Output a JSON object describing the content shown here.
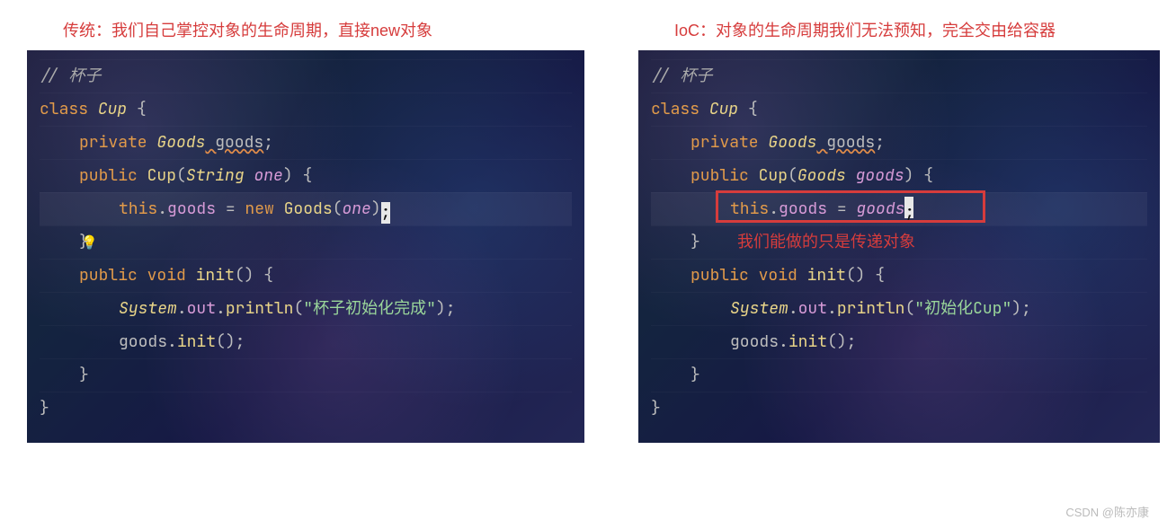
{
  "left": {
    "title": "传统：我们自己掌控对象的生命周期，直接new对象",
    "comment": "// 杯子",
    "l_class": "class ",
    "l_cup": "Cup",
    "l_ob": " {",
    "priv": "private ",
    "goods_t": "Goods",
    "goods_f": " goods",
    "semi": ";",
    "pub": "public ",
    "cup_ctor": "Cup",
    "lp": "(",
    "string_t": "String",
    "one_p": " one",
    "rp": ")",
    "ob": " {",
    "this_kw": "this",
    "dot": ".",
    "goods_f2": "goods",
    "eq": " = ",
    "new_kw": "new ",
    "goods_ctor": "Goods",
    "one_p2": "one",
    "cb": "}",
    "void_t": "void",
    "init_m": " init",
    "empty_p": "()",
    "sys": "System",
    "out": "out",
    "println": "println",
    "str1": "\"杯子初始化完成\"",
    "goods_call": "goods",
    "init_call": "init"
  },
  "right": {
    "title": "IoC：对象的生命周期我们无法预知，完全交由给容器",
    "comment": "// 杯子",
    "l_class": "class ",
    "l_cup": "Cup",
    "l_ob": " {",
    "priv": "private ",
    "goods_t": "Goods",
    "goods_f": " goods",
    "semi": ";",
    "pub": "public ",
    "cup_ctor": "Cup",
    "lp": "(",
    "goods_pt": "Goods",
    "goods_pp": " goods",
    "rp": ")",
    "ob": " {",
    "this_kw": "this",
    "dot": ".",
    "goods_f2": "goods",
    "eq": " = ",
    "goods_p2": "goods",
    "cb": "}",
    "void_t": "void",
    "init_m": " init",
    "empty_p": "()",
    "sys": "System",
    "out": "out",
    "println": "println",
    "str1": "\"初始化Cup\"",
    "goods_call": "goods",
    "init_call": "init",
    "annotation": "我们能做的只是传递对象"
  },
  "watermark": "CSDN @陈亦康"
}
